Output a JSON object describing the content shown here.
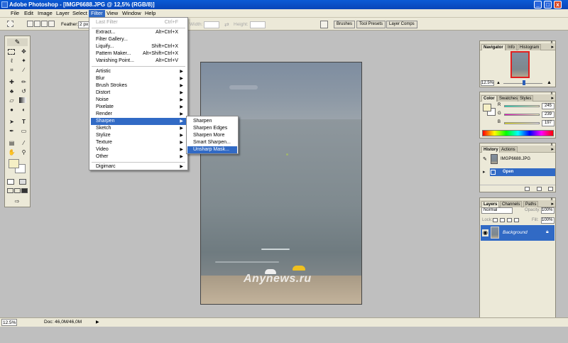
{
  "window": {
    "title": "Adobe Photoshop - [IMGP6688.JPG @ 12,5% (RGB/8)]",
    "min": "_",
    "max": "□",
    "close": "x"
  },
  "menubar": [
    "File",
    "Edit",
    "Image",
    "Layer",
    "Select",
    "Filter",
    "View",
    "Window",
    "Help"
  ],
  "active_menu": "Filter",
  "options_bar": {
    "feather_label": "Feather:",
    "feather_value": "2 px",
    "width_label": "Width:",
    "height_label": "Height:",
    "palette_tabs": [
      "Brushes",
      "Tool Presets",
      "Layer Comps"
    ]
  },
  "filter_menu": {
    "top": [
      {
        "label": "Last Filter",
        "shortcut": "Ctrl+F",
        "disabled": true
      }
    ],
    "group1": [
      {
        "label": "Extract...",
        "shortcut": "Alt+Ctrl+X"
      },
      {
        "label": "Filter Gallery...",
        "shortcut": ""
      },
      {
        "label": "Liquify...",
        "shortcut": "Shift+Ctrl+X"
      },
      {
        "label": "Pattern Maker...",
        "shortcut": "Alt+Shift+Ctrl+X"
      },
      {
        "label": "Vanishing Point...",
        "shortcut": "Alt+Ctrl+V"
      }
    ],
    "group2": [
      "Artistic",
      "Blur",
      "Brush Strokes",
      "Distort",
      "Noise",
      "Pixelate",
      "Render",
      "Sharpen",
      "Sketch",
      "Stylize",
      "Texture",
      "Video",
      "Other"
    ],
    "highlighted": "Sharpen",
    "group3": [
      "Digimarc"
    ]
  },
  "sharpen_submenu": {
    "items": [
      "Sharpen",
      "Sharpen Edges",
      "Sharpen More",
      "Smart Sharpen...",
      "Unsharp Mask..."
    ],
    "highlighted": "Unsharp Mask..."
  },
  "document": {
    "watermark": "Anynews.ru"
  },
  "navigator": {
    "tabs": [
      "Navigator",
      "Info",
      "Histogram"
    ],
    "zoom": "12.5%"
  },
  "color": {
    "tabs": [
      "Color",
      "Swatches",
      "Styles"
    ],
    "channels": [
      {
        "label": "R",
        "value": "245"
      },
      {
        "label": "G",
        "value": "239"
      },
      {
        "label": "B",
        "value": "197"
      }
    ],
    "foreground": "#f5efc5"
  },
  "history": {
    "tabs": [
      "History",
      "Actions"
    ],
    "snapshot": "IMGP6688.JPG",
    "state": "Open"
  },
  "layers": {
    "tabs": [
      "Layers",
      "Channels",
      "Paths"
    ],
    "blend_mode": "Normal",
    "opacity_label": "Opacity:",
    "opacity": "100%",
    "lock_label": "Lock:",
    "fill_label": "Fill:",
    "fill": "100%",
    "layer_name": "Background"
  },
  "status": {
    "zoom": "12.5%",
    "doc": "Doc: 46,0M/46,0M"
  },
  "colors": {
    "title_bar": "#0845b8",
    "highlight": "#316ac5",
    "chrome": "#ece9d8"
  }
}
